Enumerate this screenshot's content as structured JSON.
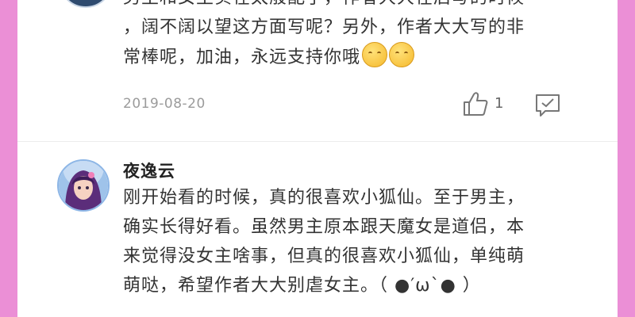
{
  "comments": [
    {
      "lines": [
        "男主和女主实在太般配了，作者大大在后写的时候",
        "，阔不阔以望这方面写呢？另外，作者大大写的非",
        "常棒呢，加油，永远支持你哦"
      ],
      "emojis": [
        "pray-emoji",
        "pray-emoji"
      ],
      "date": "2019-08-20",
      "likes": "1"
    },
    {
      "username": "夜逸云",
      "lines": [
        "刚开始看的时候，真的很喜欢小狐仙。至于男主，",
        "确实长得好看。虽然男主原本跟天魔女是道侣，本",
        "来觉得没女主啥事，但真的很喜欢小狐仙，单纯萌",
        "萌哒，希望作者大大别虐女主。（ ●′ω`● ）"
      ]
    }
  ],
  "colors": {
    "frame": "#eb8fd6",
    "text": "#333333",
    "meta": "#9b9b9b"
  }
}
